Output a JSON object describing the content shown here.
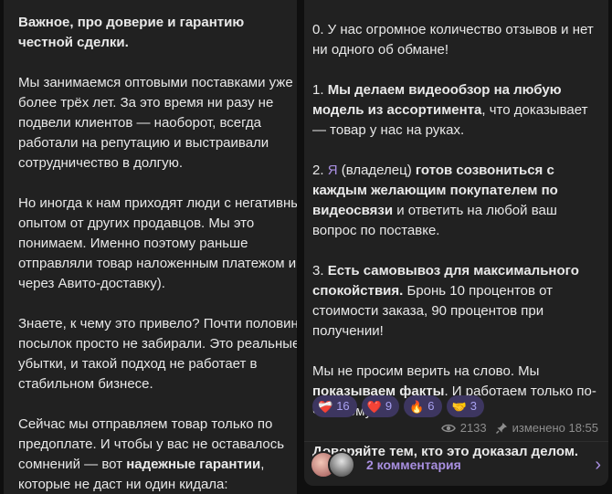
{
  "left": {
    "title": "Важное, про доверие и гарантию честной сделки.",
    "p1": "Мы занимаемся оптовыми поставками уже более трёх лет. За это время ни разу не подвели клиентов — наоборот, всегда работали на репутацию и выстраивали сотрудничество в долгую.",
    "p2": "Но иногда к нам приходят люди с негативным опытом от других продавцов. Мы это понимаем. Именно поэтому раньше отправляли товар наложенным платежом и через Авито-доставку).",
    "p3": "Знаете, к чему это привело? Почти половину посылок просто не забирали. Это реальные убытки, и такой подход не работает в стабильном бизнесе.",
    "p4_a": "Сейчас мы отправляем товар только по предоплате. И чтобы у вас не оставалось сомнений — вот ",
    "p4_b": "надежные гарантии",
    "p4_c": ", которые не даст ни один кидала:"
  },
  "right": {
    "p0": "0. У нас огромное количество отзывов и нет ни одного об обмане!",
    "p1_a": "1. ",
    "p1_b": "Мы делаем видеообзор на любую модель из ассортимента",
    "p1_c": ", что доказывает — товар у нас на руках.",
    "p2_a": "2. ",
    "p2_b": "Я",
    "p2_c": " (владелец) ",
    "p2_d": "готов созвониться с каждым желающим покупателем по видеосвязи",
    "p2_e": " и ответить на любой ваш вопрос по поставке.",
    "p3_a": "3. ",
    "p3_b": "Есть самовывоз для максимального спокойствия.",
    "p3_c": " Бронь 10 процентов от стоимости заказа, 90 процентов при получении!",
    "p4_a": "Мы не просим верить на слово. Мы ",
    "p4_b": "показываем факты",
    "p4_c": ". И работаем только по-честному.",
    "p5": "Доверяйте тем, кто это доказал делом.",
    "reactions": [
      {
        "icon": "heart-broken-icon",
        "emoji": "❤‍🩹",
        "count": "16"
      },
      {
        "icon": "heart-icon",
        "emoji": "❤️",
        "count": "9"
      },
      {
        "icon": "fire-icon",
        "emoji": "🔥",
        "count": "6"
      },
      {
        "icon": "handshake-icon",
        "emoji": "🤝",
        "count": "3"
      }
    ],
    "views": "2133",
    "edited": "изменено 18:55",
    "comments": "2 комментария"
  }
}
